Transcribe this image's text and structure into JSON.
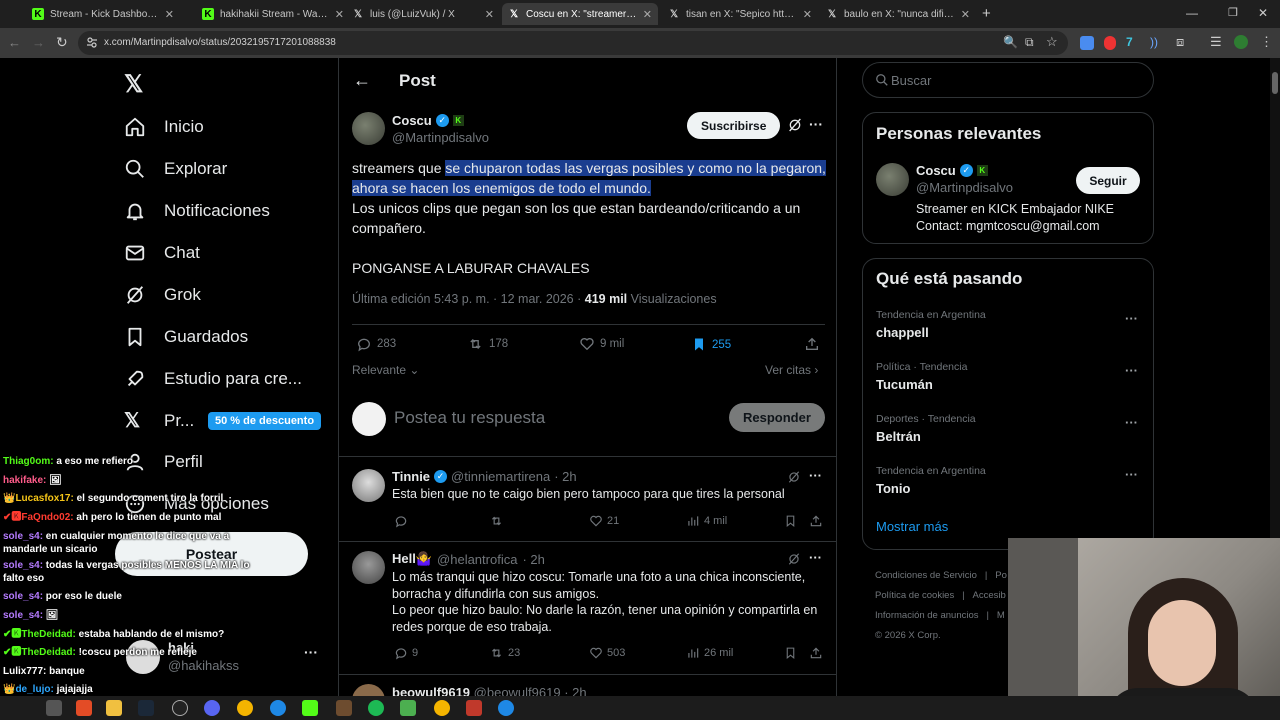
{
  "browser": {
    "tabs": [
      {
        "title": "Stream - Kick Dashboard",
        "icon": "kick-icon"
      },
      {
        "title": "hakihakii Stream - Watch Live o",
        "icon": "kick-icon"
      },
      {
        "title": "luis (@LuizVuk) / X",
        "icon": "x-icon"
      },
      {
        "title": "Coscu en X: \"streamers que se c",
        "icon": "x-icon"
      },
      {
        "title": "tisan en X: \"Sepico https://t.co/",
        "icon": "x-icon"
      },
      {
        "title": "baulo en X: \"nunca difieran con",
        "icon": "x-icon"
      }
    ],
    "url": "x.com/Martinpdisalvo/status/2032195717201088838"
  },
  "nav": {
    "items": [
      {
        "label": "Inicio",
        "icon": "home-icon"
      },
      {
        "label": "Explorar",
        "icon": "search-icon"
      },
      {
        "label": "Notificaciones",
        "icon": "bell-icon"
      },
      {
        "label": "Chat",
        "icon": "mail-icon"
      },
      {
        "label": "Grok",
        "icon": "grok-icon"
      },
      {
        "label": "Guardados",
        "icon": "bookmark-icon"
      },
      {
        "label": "Estudio para cre...",
        "icon": "rocket-icon"
      },
      {
        "label": "Pr...",
        "icon": "x-premium-icon"
      },
      {
        "label": "Perfil",
        "icon": "person-icon"
      },
      {
        "label": "Más opciones",
        "icon": "more-icon"
      }
    ],
    "promo_badge": "50 % de descuento",
    "post_button": "Postear",
    "account": {
      "name": "haki",
      "handle": "@hakihakss"
    }
  },
  "chat": [
    {
      "user": "Thiag0om:",
      "msg": " a eso me refiero",
      "color": "#53fc18"
    },
    {
      "user": "hakifake:",
      "msg": " 🖼",
      "color": "#ff5c8a"
    },
    {
      "user": "👑Lucasfox17:",
      "msg": " el segundo coment tiro la forril",
      "color": "#f5c518"
    },
    {
      "user": "✔🅺FaQndo02:",
      "msg": " ah pero lo tienen de punto mal",
      "color": "#ff3b30"
    },
    {
      "user": "sole_s4:",
      "msg": " en cualquier momento le dice que va a mandarle un sicario",
      "color": "#b57bff"
    },
    {
      "user": "sole_s4:",
      "msg": " todas la vergas posibles MENOS LA MIA lo falto eso",
      "color": "#b57bff"
    },
    {
      "user": "sole_s4:",
      "msg": " por eso le duele",
      "color": "#b57bff"
    },
    {
      "user": "sole_s4:",
      "msg": " 🖼",
      "color": "#b57bff"
    },
    {
      "user": "✔🅺TheDeidad:",
      "msg": " estaba hablando de el mismo?",
      "color": "#53fc18"
    },
    {
      "user": "✔🅺TheDeidad:",
      "msg": " !coscu perdon me refleje",
      "color": "#53fc18"
    },
    {
      "user": "Lulix777:",
      "msg": " banque",
      "color": "#ffffff"
    },
    {
      "user": "👑de_lujo:",
      "msg": " jajajajja",
      "color": "#2ea8ff"
    }
  ],
  "header": {
    "title": "Post",
    "back": "←"
  },
  "post": {
    "author": "Coscu",
    "handle": "@Martinpdisalvo",
    "subscribe": "Suscribirse",
    "text_plain": "streamers que",
    "text_highlight": "se chuparon todas las vergas posibles y como no la pegaron, ahora se hacen los enemigos de todo el mundo.",
    "line2": "Los unicos clips que pegan son los que estan bardeando/criticando a un compañero.",
    "line3": "PONGANSE A LABURAR CHAVALES",
    "edited": "Última edición 5:43 p. m. · 12 mar. 2026 ·",
    "views_count": "419 mil",
    "views_label": "Visualizaciones",
    "stats": {
      "replies": "283",
      "reposts": "178",
      "likes": "9 mil",
      "bookmarks": "255"
    },
    "sort": "Relevante",
    "quotes": "Ver citas"
  },
  "compose": {
    "placeholder": "Postea tu respuesta",
    "button": "Responder"
  },
  "replies": [
    {
      "name": "Tinnie",
      "handle": "@tinniemartirena",
      "time": "· 2h",
      "text": "Esta bien que no te caigo bien pero tampoco para que tires la personal",
      "replies": "",
      "reposts": "",
      "likes": "21",
      "views": "4 mil"
    },
    {
      "name": "Hell🤷‍♀️",
      "handle": "@helantrofica",
      "time": "· 2h",
      "text1": "Lo más tranqui que hizo coscu: Tomarle una foto a una chica inconsciente, borracha y difundirla con sus amigos.",
      "text2": "Lo peor que hizo baulo: No darle la razón, tener una opinión y compartirla en redes porque de eso trabaja.",
      "replies": "9",
      "reposts": "23",
      "likes": "503",
      "views": "26 mil"
    },
    {
      "name": "beowulf9619",
      "handle": "@beowulf9619",
      "time": "· 2h"
    }
  ],
  "search": {
    "placeholder": "Buscar"
  },
  "relevant": {
    "title": "Personas relevantes",
    "name": "Coscu",
    "handle": "@Martinpdisalvo",
    "follow": "Seguir",
    "bio": "Streamer en KICK Embajador NIKE Contact: mgmtcoscu@gmail.com"
  },
  "trends": {
    "title": "Qué está pasando",
    "items": [
      {
        "context": "Tendencia en Argentina",
        "name": "chappell"
      },
      {
        "context": "Política · Tendencia",
        "name": "Tucumán"
      },
      {
        "context": "Deportes · Tendencia",
        "name": "Beltrán"
      },
      {
        "context": "Tendencia en Argentina",
        "name": "Tonio"
      }
    ],
    "more": "Mostrar más"
  },
  "footer": {
    "links": [
      "Condiciones de Servicio",
      "|",
      "Po",
      "Política de cookies",
      "|",
      "Accesib",
      "Información de anuncios",
      "|",
      "M"
    ],
    "copyright": "© 2026 X Corp."
  },
  "colors": {
    "accent": "#1d9bf0",
    "kick": "#53fc18",
    "highlight": "#1a3d8f"
  }
}
